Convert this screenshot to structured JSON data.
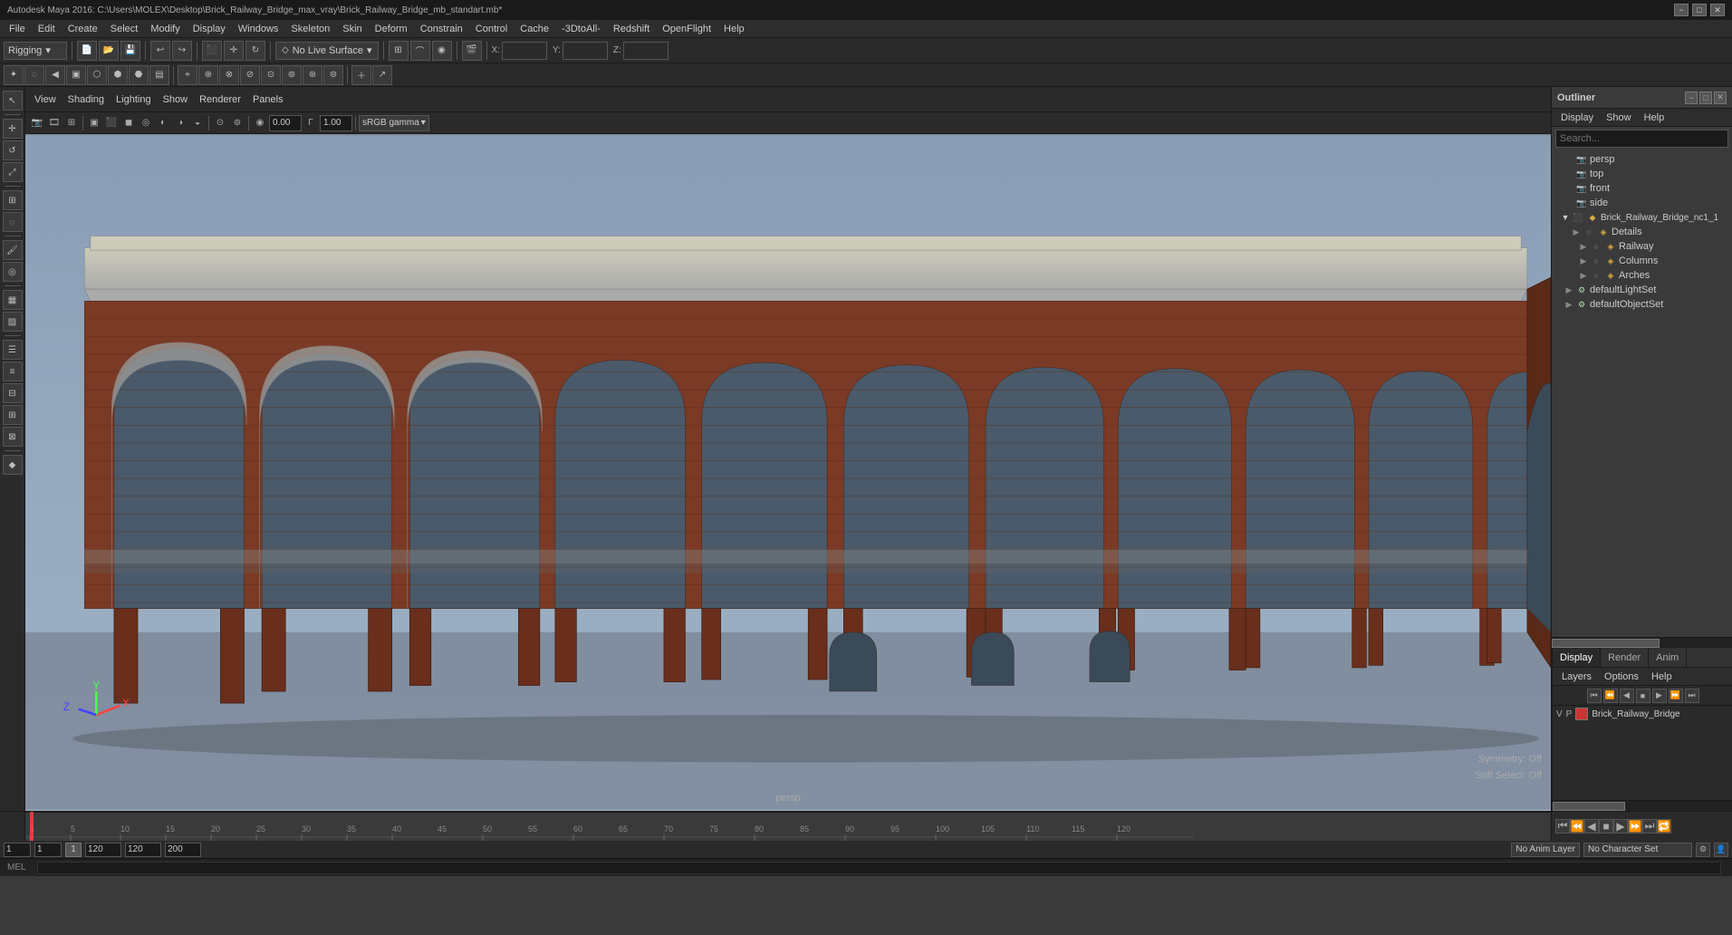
{
  "titleBar": {
    "title": "Autodesk Maya 2016: C:\\Users\\MOLEX\\Desktop\\Brick_Railway_Bridge_max_vray\\Brick_Railway_Bridge_mb_standart.mb*",
    "minimize": "−",
    "maximize": "□",
    "close": "✕"
  },
  "menuBar": {
    "items": [
      "File",
      "Edit",
      "Create",
      "Select",
      "Modify",
      "Display",
      "Windows",
      "Skeleton",
      "Skin",
      "Deform",
      "Constrain",
      "Control",
      "Cache",
      "-3DtoAll-",
      "Redshift",
      "OpenFlight",
      "Help"
    ]
  },
  "toolbar": {
    "rigging_label": "Rigging",
    "no_live_surface": "No Live Surface",
    "x_label": "X:",
    "y_label": "Y:",
    "z_label": "Z:"
  },
  "viewportMenu": {
    "items": [
      "View",
      "Shading",
      "Lighting",
      "Show",
      "Renderer",
      "Panels"
    ]
  },
  "viewportValues": {
    "value1": "0.00",
    "value2": "1.00",
    "gamma": "sRGB gamma",
    "persp_label": "persp"
  },
  "symmetry": {
    "label": "Symmetry:",
    "value": "Off",
    "soft_label": "Soft Select:",
    "soft_value": "Off"
  },
  "outliner": {
    "title": "Outliner",
    "tabs": {
      "display": "Display",
      "show": "Show",
      "help": "Help"
    },
    "search_placeholder": "Search...",
    "items": [
      {
        "label": "persp",
        "type": "camera",
        "indent": 0,
        "expand": false
      },
      {
        "label": "top",
        "type": "camera",
        "indent": 0,
        "expand": false
      },
      {
        "label": "front",
        "type": "camera",
        "indent": 0,
        "expand": false
      },
      {
        "label": "side",
        "type": "camera",
        "indent": 0,
        "expand": false
      },
      {
        "label": "Brick_Railway_Bridge_nc1_1",
        "type": "group",
        "indent": 0,
        "expand": true
      },
      {
        "label": "Details",
        "type": "group",
        "indent": 1,
        "expand": false
      },
      {
        "label": "Railway",
        "type": "group",
        "indent": 2,
        "expand": false
      },
      {
        "label": "Columns",
        "type": "group",
        "indent": 2,
        "expand": false
      },
      {
        "label": "Arches",
        "type": "group",
        "indent": 2,
        "expand": false
      },
      {
        "label": "defaultLightSet",
        "type": "shader",
        "indent": 0,
        "expand": false
      },
      {
        "label": "defaultObjectSet",
        "type": "shader",
        "indent": 0,
        "expand": false
      }
    ]
  },
  "channelBox": {
    "tabs": [
      "Display",
      "Render",
      "Anim"
    ],
    "active_tab": "Display",
    "subMenu": [
      "Layers",
      "Options",
      "Help"
    ],
    "layer": {
      "visibility": "V",
      "playback": "P",
      "color": "#cc3333",
      "name": "Brick_Railway_Bridge"
    }
  },
  "timeline": {
    "start": "1",
    "end": "120",
    "current": "1",
    "range_start": "1",
    "range_end": "200",
    "anim_layer": "No Anim Layer",
    "no_character_set": "No Character Set"
  },
  "statusBar": {
    "mel_label": "MEL"
  },
  "bottomPlayback": {
    "frame_label": "1",
    "frame_mini_label": "1",
    "frame_box": "1",
    "range_start": "120",
    "range_end": "120",
    "range_end2": "200"
  }
}
